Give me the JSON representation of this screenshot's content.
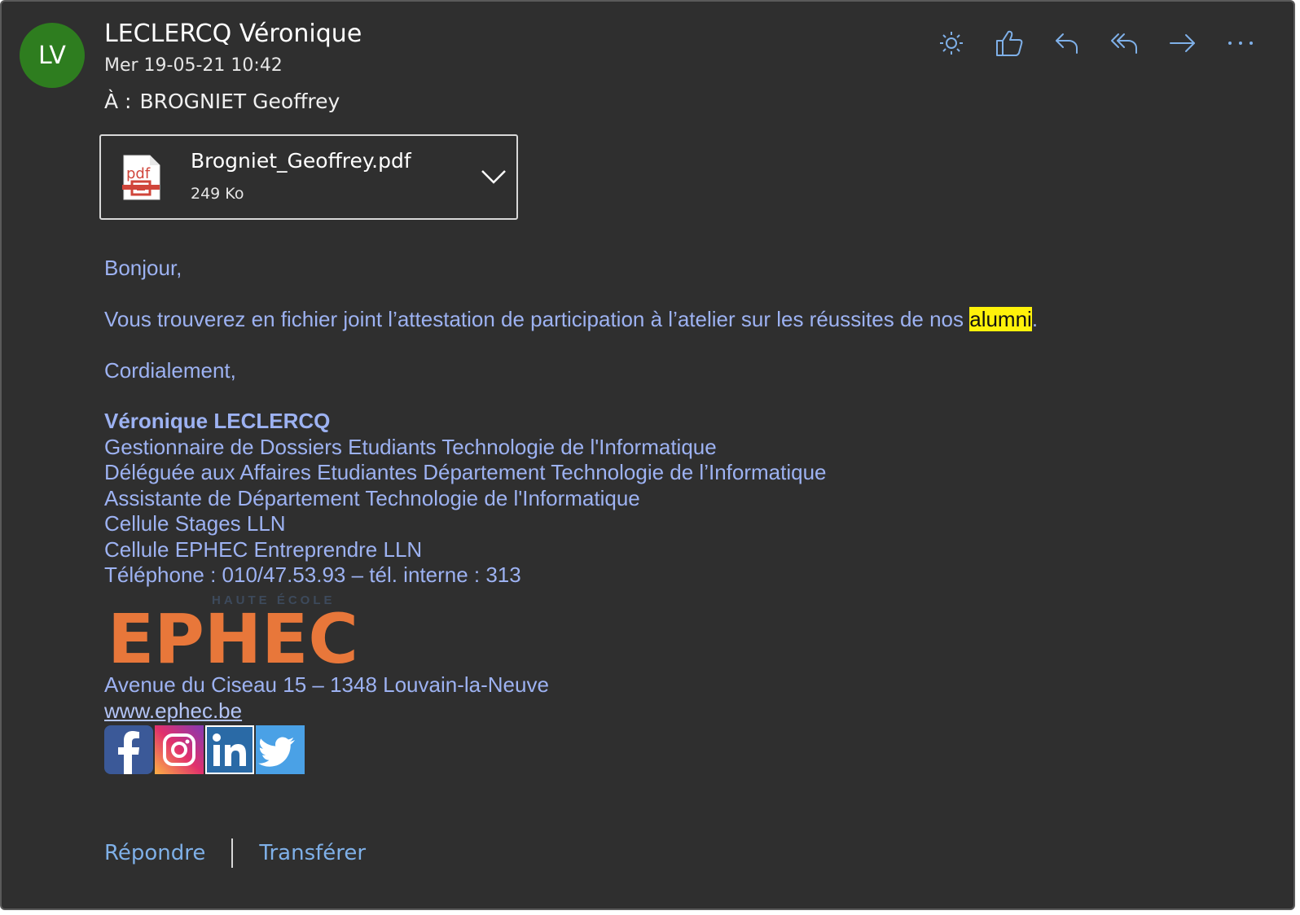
{
  "sender": {
    "initials": "LV",
    "name": "LECLERCQ Véronique",
    "date": "Mer 19-05-21 10:42",
    "to_label": "À :",
    "to_name": "BROGNIET Geoffrey"
  },
  "actions": [
    {
      "icon": "brightness-icon"
    },
    {
      "icon": "thumbs-up-icon"
    },
    {
      "icon": "reply-icon"
    },
    {
      "icon": "reply-all-icon"
    },
    {
      "icon": "forward-icon"
    },
    {
      "icon": "more-icon"
    }
  ],
  "attachment": {
    "icon_label": "pdf",
    "name": "Brogniet_Geoffrey.pdf",
    "size": "249 Ko"
  },
  "message": {
    "greeting": "Bonjour,",
    "line1_before": "Vous trouverez en fichier joint l’attestation de participation à l’atelier sur les réussites de nos ",
    "line1_highlight": "alumni",
    "line1_after": ".",
    "closing": "Cordialement,"
  },
  "signature": {
    "name": "Véronique LECLERCQ",
    "lines": [
      "Gestionnaire de Dossiers Etudiants Technologie de l'Informatique",
      "Déléguée aux Affaires Etudiantes Département Technologie de l’Informatique",
      "Assistante de Département Technologie de l'Informatique",
      "Cellule Stages LLN",
      "Cellule EPHEC Entreprendre LLN",
      "Téléphone : 010/47.53.93 – tél. interne : 313"
    ],
    "logo_small": "HAUTE ÉCOLE",
    "logo_text": "EPHEC",
    "address": "Avenue du Ciseau 15 – 1348 Louvain-la-Neuve",
    "website": "www.ephec.be"
  },
  "social": [
    {
      "icon": "facebook-icon"
    },
    {
      "icon": "instagram-icon"
    },
    {
      "icon": "linkedin-icon"
    },
    {
      "icon": "twitter-icon"
    }
  ],
  "footer": {
    "reply": "Répondre",
    "forward": "Transférer"
  },
  "colors": {
    "background": "#2f2f2f",
    "avatar": "#2e7d1f",
    "body_text": "#9db2f2",
    "highlight": "#fff20a",
    "link_action": "#7fb0e8",
    "logo": "#e8773a"
  }
}
